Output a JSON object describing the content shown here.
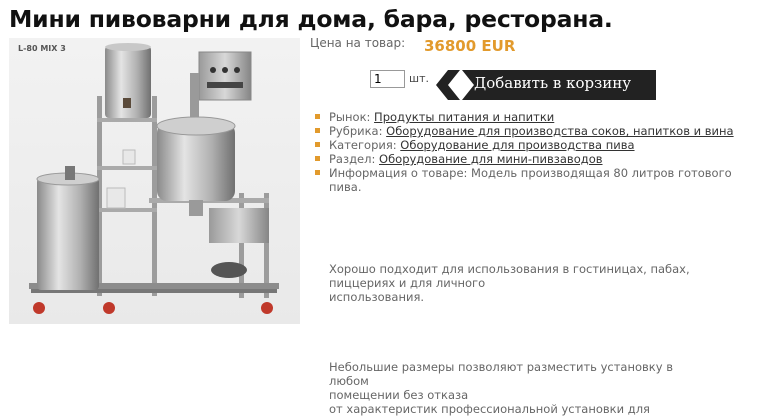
{
  "product": {
    "title": "Мини пивоварни для дома, бара, ресторана.",
    "photo_caption": "L-80 MIX 3",
    "price_label": "Цена на товар:",
    "price": "36800 EUR",
    "quantity": "1",
    "unit": "шт.",
    "add_to_cart": "Добавить в корзину"
  },
  "meta": [
    {
      "label": "Рынок:",
      "link": "Продукты питания и напитки"
    },
    {
      "label": "Рубрика:",
      "link": "Оборудование для производства соков, напитков и вина"
    },
    {
      "label": "Категория:",
      "link": "Оборудование для производства пива"
    },
    {
      "label": "Раздел:",
      "link": "Оборудование для мини-пивзаводов"
    },
    {
      "label": "Информация о товаре: Модель производящая 80 литров готового пива.",
      "link": ""
    }
  ],
  "description": {
    "para1": [
      "Хорошо подходит для использования в гостиницах, пабах,",
      "пиццериях и для личного",
      "использования."
    ],
    "para2": [
      "Небольшие размеры позволяют разместить установку в любом",
      "помещении без отказа",
      "от характеристик профессиональной установки для"
    ]
  },
  "colors": {
    "accent": "#e29a2c",
    "button": "#222222"
  }
}
